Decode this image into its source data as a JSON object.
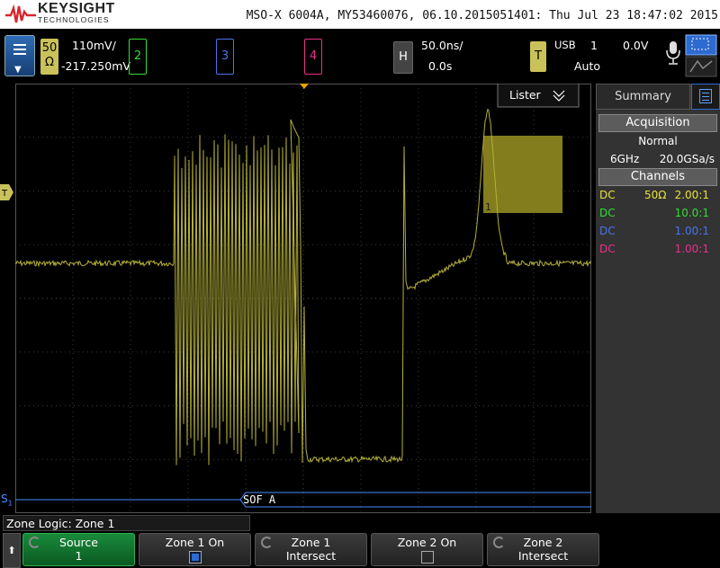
{
  "header": {
    "brand": "KEYSIGHT",
    "brand_sub": "TECHNOLOGIES",
    "info": "MSO-X 6004A, MY53460076, 06.10.2015051401: Thu Jul 23 18:47:02 2015"
  },
  "controls": {
    "ch1_box": "50",
    "ch1_box2": "Ω",
    "ch1_scale": "110mV/",
    "ch1_offset": "-217.250mV",
    "ch2": "2",
    "ch3": "3",
    "ch4": "4",
    "horiz_label": "H",
    "time_scale": "50.0ns/",
    "time_delay": "0.0s",
    "trig_label": "T",
    "trig_source": "USB",
    "trig_channel": "1",
    "trig_level": "0.0V",
    "trig_mode": "Auto"
  },
  "display": {
    "lister_label": "Lister",
    "serial_label": "S",
    "serial_sub": "1",
    "decode_text": "SOF  A",
    "trigger_marker": "T",
    "zone_label": "1"
  },
  "sidebar": {
    "tab": "Summary",
    "acq_header": "Acquisition",
    "acq_mode": "Normal",
    "bandwidth": "6GHz",
    "sample_rate": "20.0GSa/s",
    "ch_header": "Channels",
    "channels": [
      {
        "coupling": "DC",
        "impedance": "50Ω",
        "probe": "2.00:1",
        "color": "#e8e23c"
      },
      {
        "coupling": "DC",
        "impedance": "",
        "probe": "10.0:1",
        "color": "#33dd33"
      },
      {
        "coupling": "DC",
        "impedance": "",
        "probe": "1.00:1",
        "color": "#4a73e8"
      },
      {
        "coupling": "DC",
        "impedance": "",
        "probe": "1.00:1",
        "color": "#e8308a"
      }
    ]
  },
  "bottom": {
    "title": "Zone Logic: Zone 1",
    "softkeys": [
      {
        "line1": "Source",
        "line2": "1"
      },
      {
        "line1": "Zone 1 On",
        "line2": ""
      },
      {
        "line1": "Zone 1",
        "line2": "Intersect"
      },
      {
        "line1": "Zone 2 On",
        "line2": ""
      },
      {
        "line1": "Zone 2",
        "line2": "Intersect"
      }
    ]
  },
  "colors": {
    "ch1": "#b5b03a",
    "zone": "#8a8420",
    "serial": "#4a8cff"
  }
}
